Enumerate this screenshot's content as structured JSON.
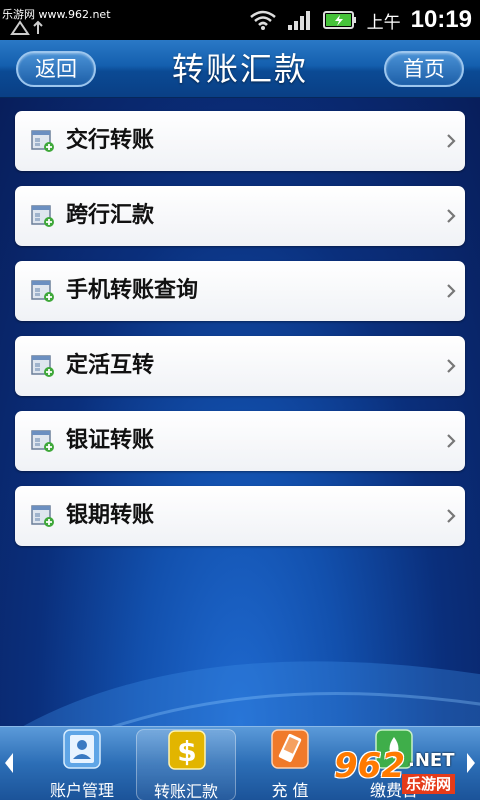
{
  "status_bar": {
    "watermark": "乐游网 www.962.net",
    "ampm": "上午",
    "time": "10:19"
  },
  "header": {
    "title": "转账汇款",
    "back_label": "返回",
    "home_label": "首页"
  },
  "menu": {
    "items": [
      {
        "label": "交行转账",
        "icon": "form-add-icon"
      },
      {
        "label": "跨行汇款",
        "icon": "form-add-icon"
      },
      {
        "label": "手机转账查询",
        "icon": "form-add-icon"
      },
      {
        "label": "定活互转",
        "icon": "form-add-icon"
      },
      {
        "label": "银证转账",
        "icon": "form-add-icon"
      },
      {
        "label": "银期转账",
        "icon": "form-add-icon"
      }
    ]
  },
  "tabs": [
    {
      "label": "账户管理",
      "icon": "account-card-icon",
      "active": false
    },
    {
      "label": "转账汇款",
      "icon": "dollar-icon",
      "active": true
    },
    {
      "label": "充 值",
      "icon": "phone-recharge-icon",
      "active": false
    },
    {
      "label": "缴费台",
      "icon": "payment-icon",
      "active": false
    }
  ],
  "watermark_logo": {
    "number": "962",
    "suffix": ".NET",
    "name": "乐游网"
  },
  "colors": {
    "header_blue": "#145fae",
    "background_navy": "#0a2f7c",
    "tab_bar_blue": "#2c6eb6",
    "battery_green": "#46c23a"
  }
}
